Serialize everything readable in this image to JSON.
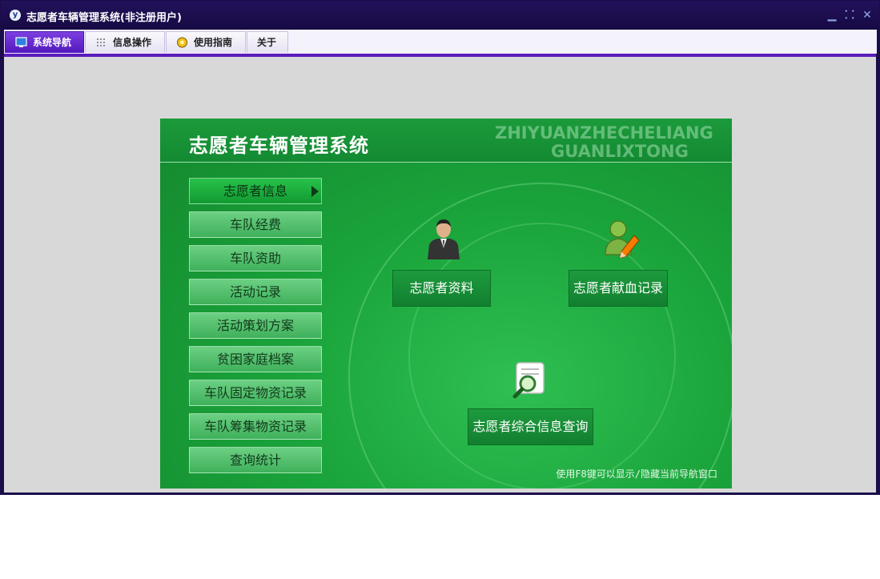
{
  "window": {
    "title": "志愿者车辆管理系统(非注册用户)",
    "logo_text": "y",
    "controls": {
      "minimize": "▁",
      "restore": "⸬",
      "close": "✕"
    }
  },
  "tabs": [
    {
      "label": "系统导航",
      "icon": "monitor-icon",
      "active": true
    },
    {
      "label": "信息操作",
      "icon": "grid-icon",
      "active": false
    },
    {
      "label": "使用指南",
      "icon": "help-circle-icon",
      "active": false
    },
    {
      "label": "关于",
      "icon": "",
      "active": false
    }
  ],
  "panel": {
    "title": "志愿者车辆管理系统",
    "watermark_line1": "ZHIYUANZHECHELIANG",
    "watermark_line2": "GUANLIXTONG",
    "hint": "使用F8键可以显示/隐藏当前导航窗口"
  },
  "menu": [
    {
      "label": "志愿者信息",
      "active": true
    },
    {
      "label": "车队经费",
      "active": false
    },
    {
      "label": "车队资助",
      "active": false
    },
    {
      "label": "活动记录",
      "active": false
    },
    {
      "label": "活动策划方案",
      "active": false
    },
    {
      "label": "贫困家庭档案",
      "active": false
    },
    {
      "label": "车队固定物资记录",
      "active": false
    },
    {
      "label": "车队筹集物资记录",
      "active": false
    },
    {
      "label": "查询统计",
      "active": false
    }
  ],
  "actions": [
    {
      "label": "志愿者资料",
      "icon": "person-icon"
    },
    {
      "label": "志愿者献血记录",
      "icon": "user-edit-icon"
    },
    {
      "label": "志愿者综合信息查询",
      "icon": "search-document-icon"
    }
  ],
  "colors": {
    "titlebar": "#1b0d4a",
    "tab_active": "#5a1dbb",
    "panel_green": "#1aa43b",
    "content_bg": "#d8d8d8"
  }
}
